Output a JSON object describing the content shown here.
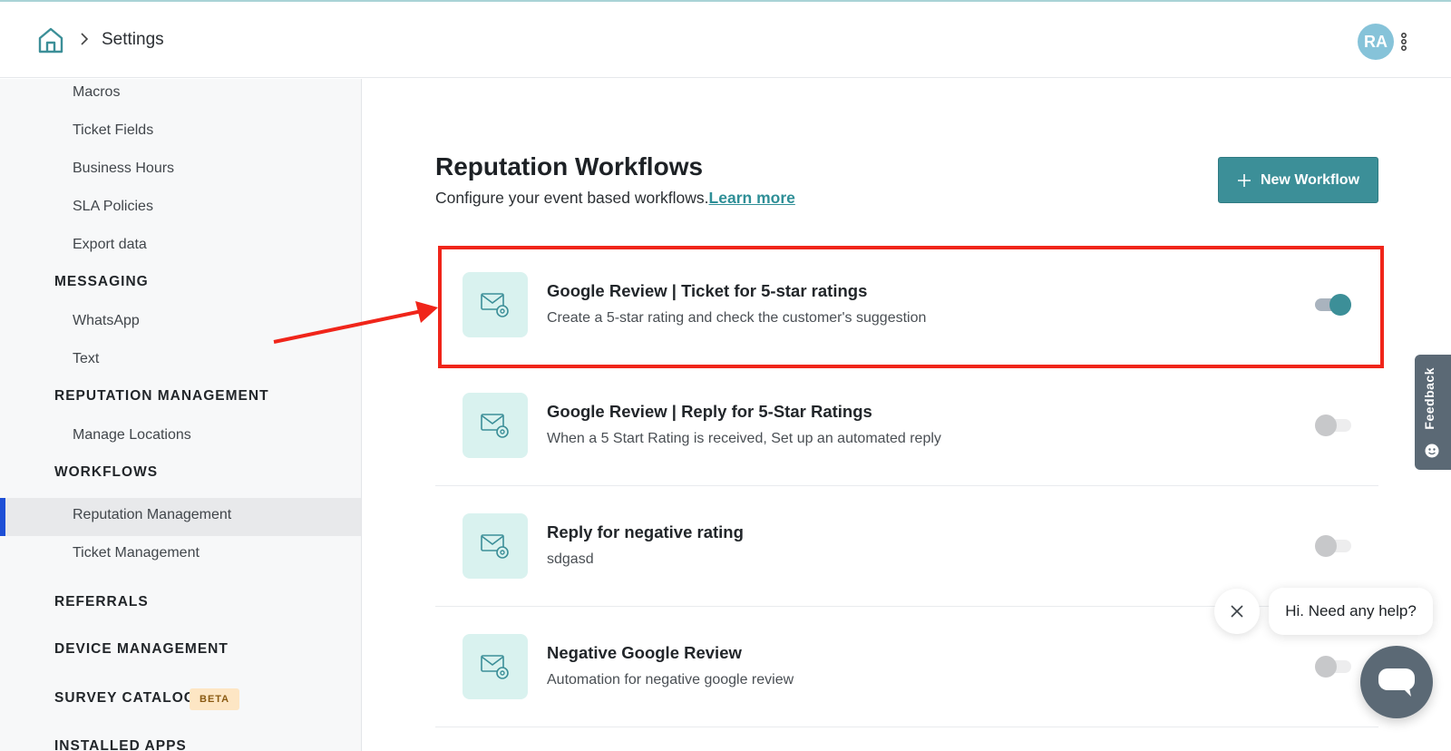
{
  "header": {
    "breadcrumb": "Settings",
    "avatar_initials": "RA"
  },
  "sidebar": {
    "items": [
      {
        "label": "Macros",
        "kind": "item"
      },
      {
        "label": "Ticket Fields",
        "kind": "item"
      },
      {
        "label": "Business Hours",
        "kind": "item"
      },
      {
        "label": "SLA Policies",
        "kind": "item"
      },
      {
        "label": "Export data",
        "kind": "item"
      },
      {
        "label": "MESSAGING",
        "kind": "section"
      },
      {
        "label": "WhatsApp",
        "kind": "item"
      },
      {
        "label": "Text",
        "kind": "item"
      },
      {
        "label": "REPUTATION MANAGEMENT",
        "kind": "section"
      },
      {
        "label": "Manage Locations",
        "kind": "item"
      },
      {
        "label": "WORKFLOWS",
        "kind": "section"
      },
      {
        "label": "Reputation Management",
        "kind": "item",
        "active": true
      },
      {
        "label": "Ticket Management",
        "kind": "item"
      },
      {
        "label": "REFERRALS",
        "kind": "section"
      },
      {
        "label": "DEVICE MANAGEMENT",
        "kind": "section"
      },
      {
        "label": "SURVEY CATALOG",
        "kind": "section"
      },
      {
        "label": "INSTALLED APPS",
        "kind": "section"
      }
    ],
    "beta_badge": "BETA",
    "active_color": "#1e4fd6"
  },
  "main": {
    "title": "Reputation Workflows",
    "subtitle": "Configure your event based workflows.",
    "learn_more": "Learn more",
    "new_workflow_label": "New Workflow",
    "accent_color": "#3c8f98",
    "workflows": [
      {
        "title": "Google Review | Ticket for 5-star ratings",
        "description": "Create a 5-star rating and check the customer's suggestion",
        "enabled": true
      },
      {
        "title": "Google Review | Reply for 5-Star Ratings",
        "description": "When a 5 Start Rating is received, Set up an automated reply",
        "enabled": false
      },
      {
        "title": "Reply for negative rating",
        "description": "sdgasd",
        "enabled": false
      },
      {
        "title": "Negative Google Review",
        "description": "Automation for negative google review",
        "enabled": false
      }
    ]
  },
  "annotation": {
    "color": "#f0251a"
  },
  "feedback": {
    "label": "Feedback"
  },
  "chat": {
    "greeting": "Hi. Need any help?"
  }
}
